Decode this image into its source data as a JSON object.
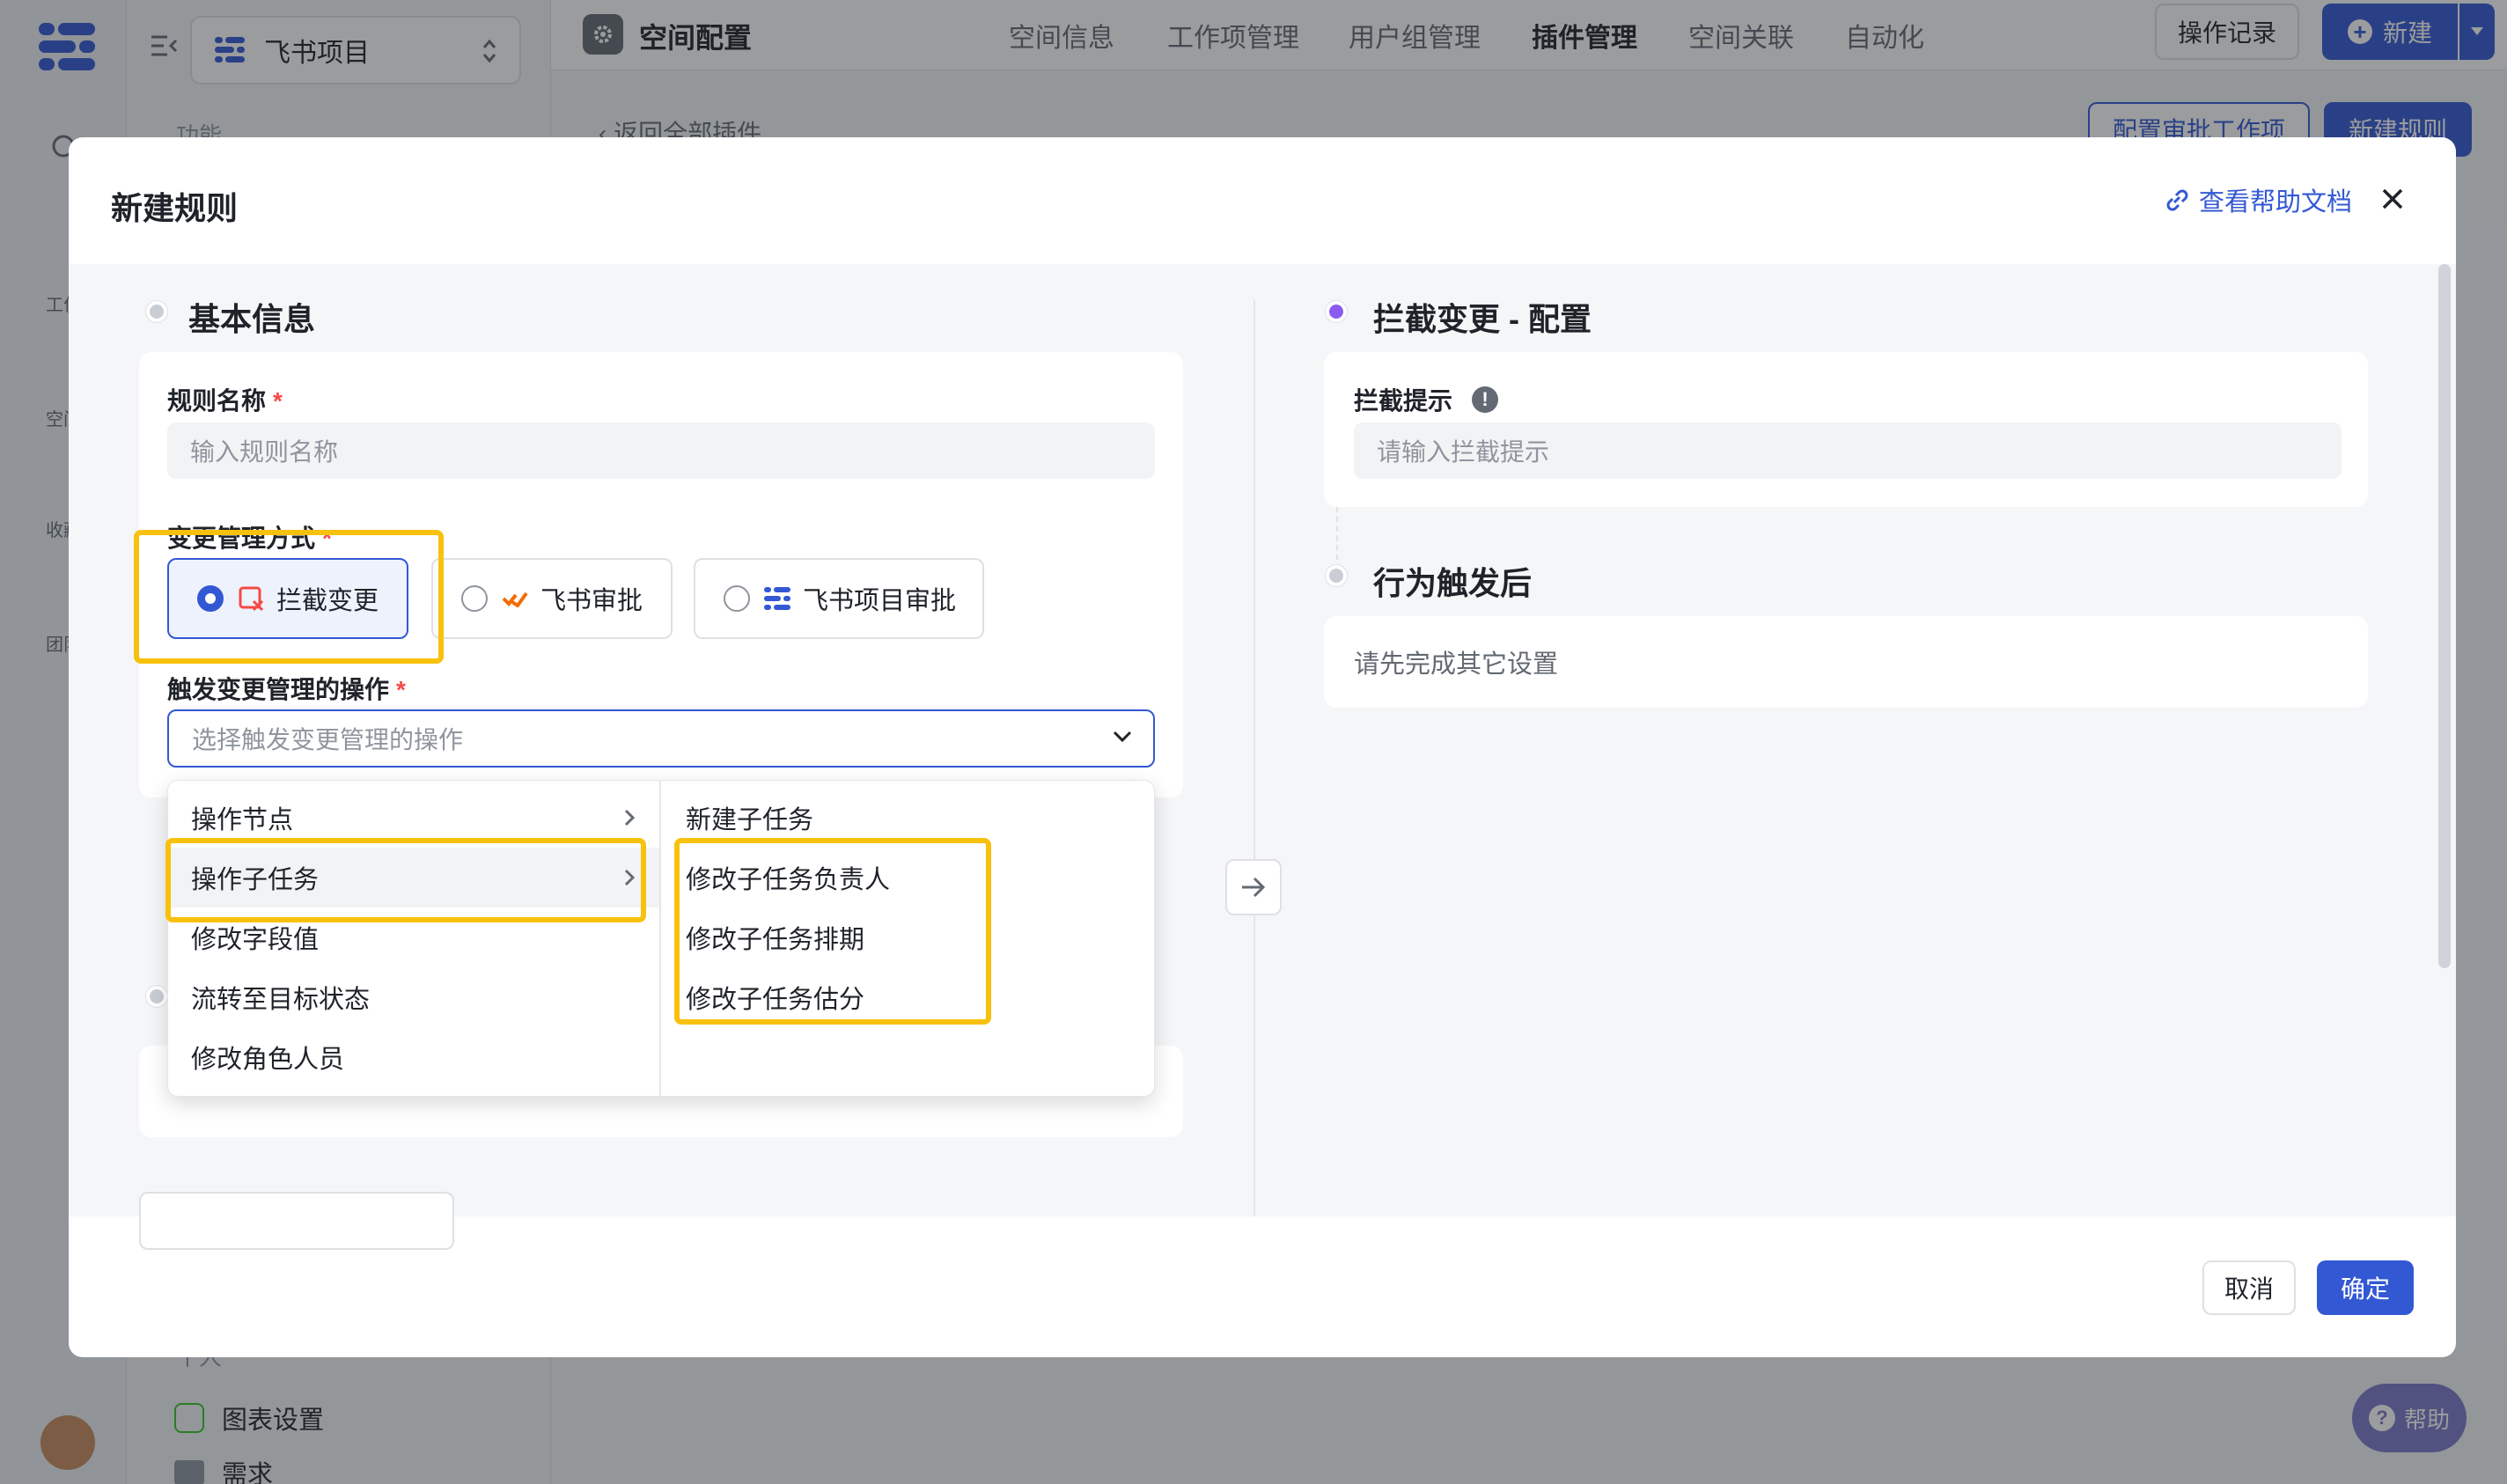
{
  "app": {
    "project_name": "飞书项目",
    "space_config_title": "空间配置",
    "nav_tabs": [
      "空间信息",
      "工作项管理",
      "用户组管理",
      "插件管理",
      "空间关联",
      "自动化"
    ],
    "active_tab": "插件管理",
    "op_log_button": "操作记录",
    "new_button": "新建",
    "back_link": "返回全部插件",
    "config_approval_button": "配置审批工作项",
    "new_rule_button": "新建规则",
    "side_group_label": "功能",
    "side_bottom_group_label": "个人",
    "side_bottom_items": [
      "图表设置",
      "需求"
    ],
    "rail_items": [
      "工作",
      "空间",
      "收藏",
      "团队"
    ],
    "help_button": "帮助"
  },
  "modal": {
    "title": "新建规则",
    "help_doc_link": "查看帮助文档",
    "left": {
      "basic_section_title": "基本信息",
      "rule_name_label": "规则名称",
      "rule_name_placeholder": "输入规则名称",
      "change_mode_label": "变更管理方式",
      "change_modes": [
        "拦截变更",
        "飞书审批",
        "飞书项目审批"
      ],
      "selected_mode": "拦截变更",
      "trigger_label": "触发变更管理的操作",
      "trigger_placeholder": "选择触发变更管理的操作"
    },
    "dropdown": {
      "level1": [
        "操作节点",
        "操作子任务",
        "修改字段值",
        "流转至目标状态",
        "修改角色人员"
      ],
      "level1_active": "操作子任务",
      "level2": [
        "新建子任务",
        "修改子任务负责人",
        "修改子任务排期",
        "修改子任务估分"
      ]
    },
    "right": {
      "config_section_title": "拦截变更 - 配置",
      "intercept_hint_label": "拦截提示",
      "intercept_hint_placeholder": "请输入拦截提示",
      "after_section_title": "行为触发后",
      "after_placeholder_text": "请先完成其它设置"
    },
    "footer": {
      "cancel": "取消",
      "confirm": "确定"
    }
  },
  "colors": {
    "primary": "#3358d4",
    "highlight": "#f8c10e",
    "required": "#f54a45",
    "config_dot": "#8c5cf0"
  }
}
